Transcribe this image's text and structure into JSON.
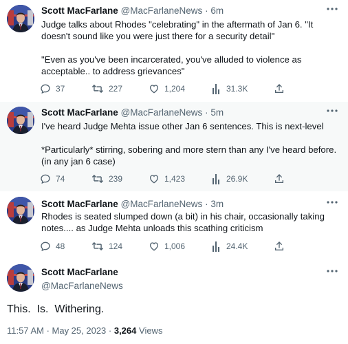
{
  "tweets": [
    {
      "name": "Scott MacFarlane",
      "handle": "@MacFarlaneNews",
      "sep": "·",
      "time": "6m",
      "text": "Judge talks about Rhodes \"celebrating\" in the aftermath of Jan 6.  \"It doesn't sound like you were just there for a security detail\"\n\n\"Even as you've been incarcerated, you've alluded to violence as acceptable.. to address grievances\"",
      "replies": "37",
      "retweets": "227",
      "likes": "1,204",
      "views": "31.3K"
    },
    {
      "name": "Scott MacFarlane",
      "handle": "@MacFarlaneNews",
      "sep": "·",
      "time": "5m",
      "text": "I've heard Judge Mehta issue other Jan 6 sentences.  This is next-level\n\n*Particularly* stirring, sobering and more stern than any I've heard before. (in any jan 6 case)",
      "replies": "74",
      "retweets": "239",
      "likes": "1,423",
      "views": "26.9K"
    },
    {
      "name": "Scott MacFarlane",
      "handle": "@MacFarlaneNews",
      "sep": "·",
      "time": "3m",
      "text": "Rhodes is seated slumped down (a bit) in his chair, occasionally taking notes....  as Judge Mehta unloads this scathing criticism",
      "replies": "48",
      "retweets": "124",
      "likes": "1,006",
      "views": "24.4K"
    }
  ],
  "main_tweet": {
    "name": "Scott MacFarlane",
    "handle": "@MacFarlaneNews",
    "text": "This.  Is.  Withering.",
    "timestamp": "11:57 AM · May 25, 2023 · ",
    "views_count": "3,264",
    "views_label": " Views"
  },
  "colors": {
    "muted": "#536471",
    "text": "#0f1419",
    "highlight_bg": "#f7f9f9"
  },
  "icons": [
    "reply-icon",
    "retweet-icon",
    "like-icon",
    "views-icon",
    "share-icon",
    "more-icon"
  ]
}
